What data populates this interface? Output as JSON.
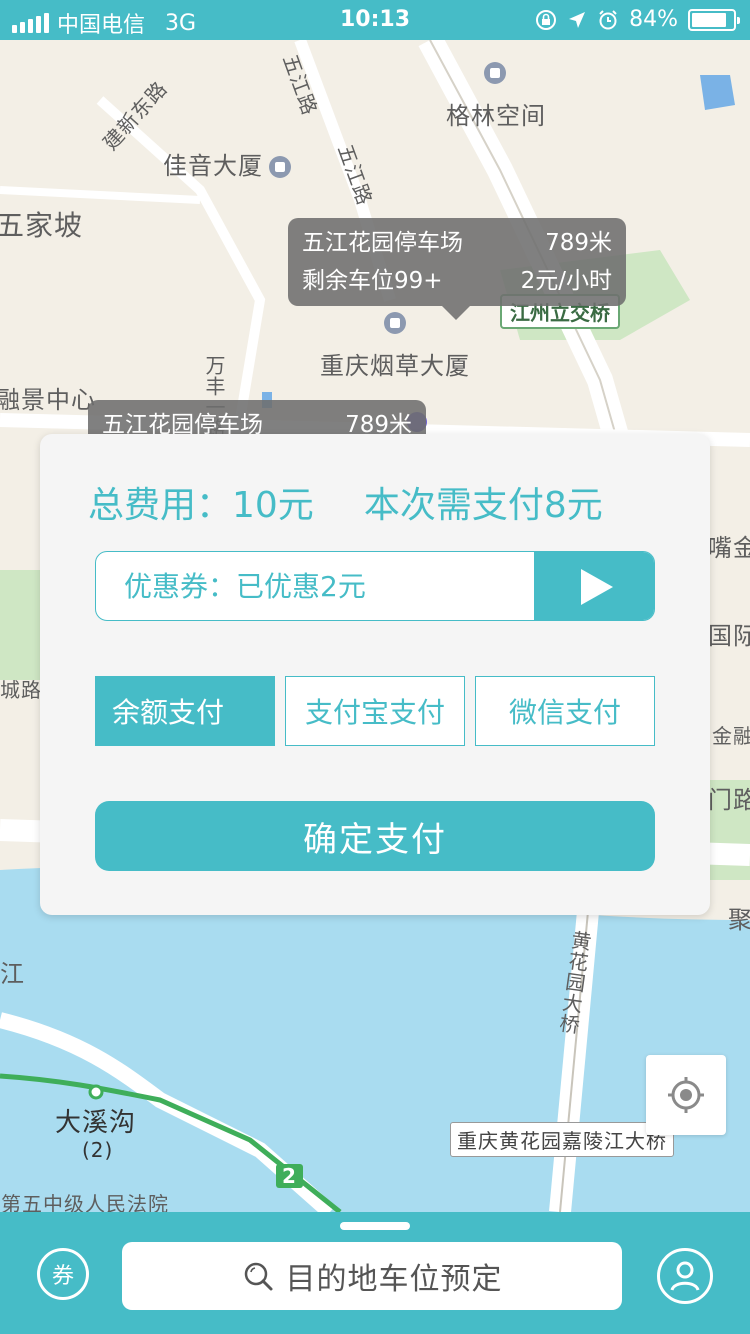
{
  "status_bar": {
    "carrier": "中国电信",
    "network": "3G",
    "time": "10:13",
    "battery_percent": "84%",
    "battery_level": 0.84
  },
  "map": {
    "labels": {
      "jianxin_road": "建新东路",
      "wujiang_road_1": "五江路",
      "wujiang_road_2": "五江路",
      "gelin": "格林空间",
      "jiayin": "佳音大厦",
      "wujiapo": "五家坡",
      "jiangzhou_bridge": "江州立交桥",
      "wanfeng_road": "万丰一路",
      "tobacco_building": "重庆烟草大厦",
      "rongjing": "融景中心",
      "zuijin": "嘴金",
      "guoji": "国际",
      "chenglu": "城路",
      "jin": "金融",
      "menlu": "门路",
      "ju": "聚",
      "jiang": "江",
      "huanghuayuan_bridge": "黄花园大桥",
      "daxigou": "大溪沟",
      "daxigou_num": "(2)",
      "line_num": "2",
      "court": "市第五中级人民法院",
      "jialing_bridge": "重庆黄花园嘉陵江大桥"
    },
    "bubble_main": {
      "name": "五江花园停车场",
      "distance": "789米",
      "spaces": "剩余车位99+",
      "price": "2元/小时"
    },
    "bubble_secondary": {
      "name": "五江花园停车场",
      "distance": "789米"
    }
  },
  "payment": {
    "total_fee": "总费用：10元",
    "pay_amount": "本次需支付8元",
    "coupon_text": "优惠券：已优惠2元",
    "methods": [
      "余额支付",
      "支付宝支付",
      "微信支付"
    ],
    "confirm_label": "确定支付"
  },
  "bottom_bar": {
    "coupon_icon_label": "券",
    "search_placeholder": "目的地车位预定"
  },
  "colors": {
    "accent": "#46bcc7",
    "water": "#a9dcf0",
    "map_bg": "#f3efe6"
  }
}
